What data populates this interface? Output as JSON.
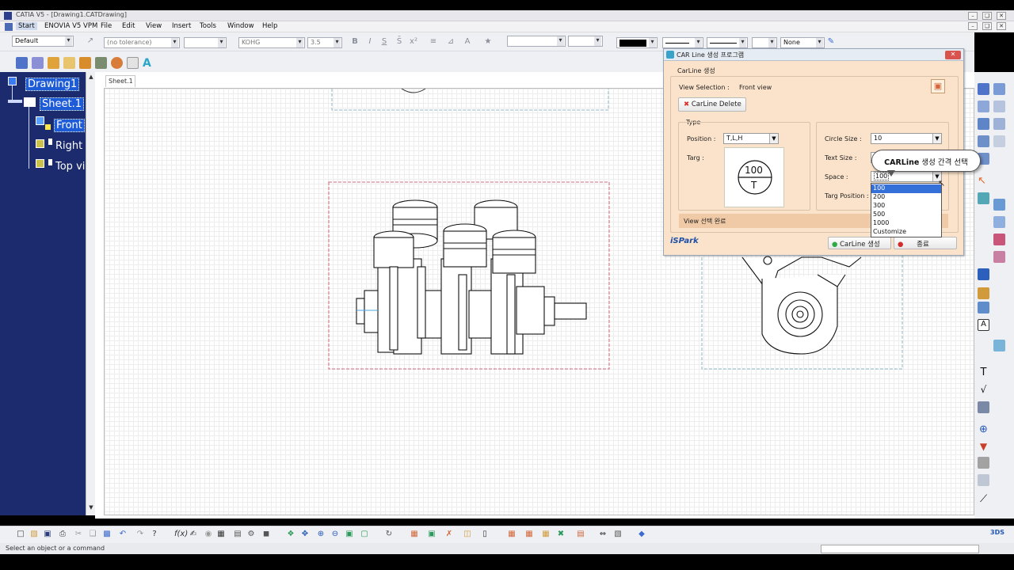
{
  "window": {
    "title": "CATIA V5 - [Drawing1.CATDrawing]"
  },
  "menu": [
    "Start",
    "ENOVIA V5 VPM",
    "File",
    "Edit",
    "View",
    "Insert",
    "Tools",
    "Window",
    "Help"
  ],
  "toolbar": {
    "style": "Default",
    "tolerance": "(no tolerance)",
    "font": "KOHG",
    "font_size": "3.5",
    "line_style": "None"
  },
  "tree": {
    "drawing": "Drawing1",
    "sheet": "Sheet.1",
    "views": [
      "Front",
      "Right",
      "Top vi"
    ]
  },
  "sheet_tab": "Sheet.1",
  "dialog": {
    "title": "CAR Line 생성 프로그램",
    "group_label": "CarLine 생성",
    "view_selection_label": "View Selection :",
    "view_selection_value": "Front view",
    "delete_button": "CarLine Delete",
    "type_label": "Type",
    "position_label": "Position :",
    "position_value": "T,L,H",
    "targ_label": "Targ :",
    "targ_top": "100",
    "targ_bottom": "T",
    "circle_size_label": "Circle Size :",
    "circle_size_value": "10",
    "text_size_label": "Text Size :",
    "space_label": "Space :",
    "space_value": "100",
    "targ_position_label": "Targ Position :",
    "status": "View 선택 완료",
    "logo": "iSPark",
    "create_button": "CarLine 생성",
    "exit_button": "종료",
    "space_options": [
      "100",
      "200",
      "300",
      "500",
      "1000",
      "Customize"
    ]
  },
  "tooltip": {
    "bold": "CARLine",
    "rest": " 생성 간격 선택"
  },
  "status": {
    "message": "Select an object or a command"
  }
}
